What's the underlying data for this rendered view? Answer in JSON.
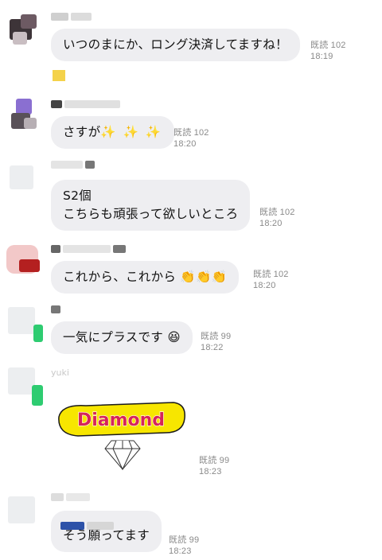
{
  "messages": [
    {
      "text": [
        "いつのまにか、ロング決済してますね！"
      ],
      "read": "既読 102",
      "time": "18:19"
    },
    {
      "text": [
        "さすが"
      ],
      "read": "既読 102",
      "time": "18:20"
    },
    {
      "text": [
        "S2個",
        "こちらも頑張って欲しいところ"
      ],
      "read": "既読 102",
      "time": "18:20"
    },
    {
      "text": [
        "これから、これから"
      ],
      "read": "既読 102",
      "time": "18:20"
    },
    {
      "text": [
        "一気にプラスです"
      ],
      "read": "既読 99",
      "time": "18:22"
    },
    {
      "sticker_text": "Diamond",
      "read": "既読 99",
      "time": "18:23"
    },
    {
      "text": [
        "そう願ってます"
      ],
      "read": "既読 99",
      "time": "18:23"
    }
  ],
  "sender_names": {
    "m6": "yuki"
  },
  "icons": {
    "sparkles": "sparkles-emoji",
    "clap": "clapping-hands-emoji",
    "grin": "grinning-squinting-emoji",
    "diamond": "diamond-icon"
  }
}
